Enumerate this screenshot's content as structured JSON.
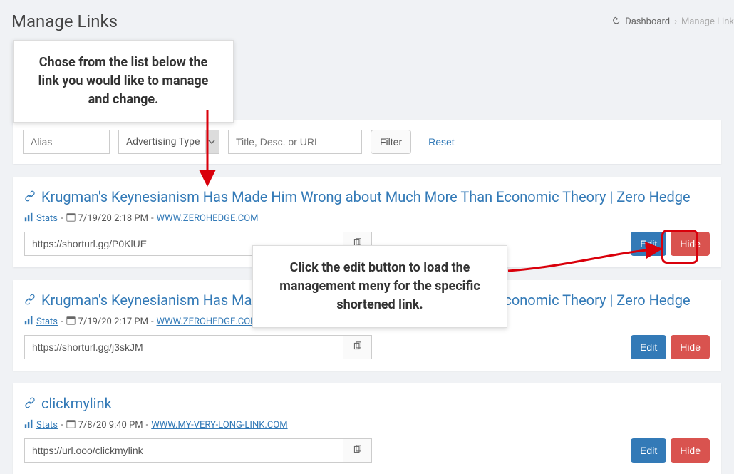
{
  "pageTitle": "Manage Links",
  "breadcrumb": {
    "dashboard": "Dashboard",
    "current": "Manage Link"
  },
  "tooltips": {
    "choose": "Chose from the list below the link you would like to manage and change.",
    "edit": "Click the edit button to load the management meny for the specific shortened link."
  },
  "filters": {
    "aliasPlaceholder": "Alias",
    "advType": "Advertising Type",
    "titlePlaceholder": "Title, Desc. or URL",
    "filterLabel": "Filter",
    "resetLabel": "Reset"
  },
  "common": {
    "statsLabel": "Stats",
    "editLabel": "Edit",
    "hideLabel": "Hide"
  },
  "links": [
    {
      "title": "Krugman's Keynesianism Has Made Him Wrong about Much More Than Economic Theory | Zero Hedge",
      "timestamp": "7/19/20 2:18 PM",
      "domain": "WWW.ZEROHEDGE.COM",
      "shortUrl": "https://shorturl.gg/P0KlUE"
    },
    {
      "title": "Krugman's Keynesianism Has Made Him Wrong about Much More Than Economic Theory | Zero Hedge",
      "timestamp": "7/19/20 2:17 PM",
      "domain": "WWW.ZEROHEDGE.COM",
      "shortUrl": "https://shorturl.gg/j3skJM"
    },
    {
      "title": "clickmylink",
      "timestamp": "7/8/20 9:40 PM",
      "domain": "WWW.MY-VERY-LONG-LINK.COM",
      "shortUrl": "https://url.ooo/clickmylink"
    }
  ]
}
